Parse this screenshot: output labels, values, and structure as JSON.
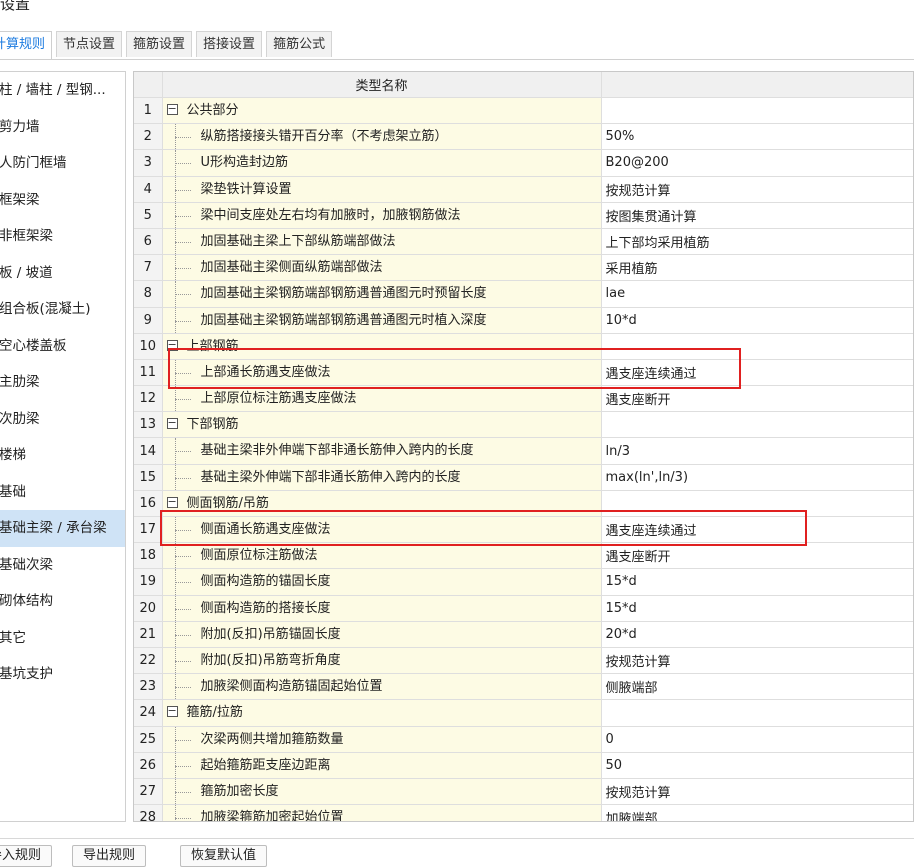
{
  "window_title": "设置",
  "tabs": [
    "计算规则",
    "节点设置",
    "箍筋设置",
    "搭接设置",
    "箍筋公式"
  ],
  "sidebar": [
    "柱 / 墙柱 / 型钢...",
    "剪力墙",
    "人防门框墙",
    "框架梁",
    "非框架梁",
    "板 / 坡道",
    "组合板(混凝土)",
    "空心楼盖板",
    "主肋梁",
    "次肋梁",
    "楼梯",
    "基础",
    "基础主梁 / 承台梁",
    "基础次梁",
    "砌体结构",
    "其它",
    "基坑支护"
  ],
  "grid": {
    "col_header": "类型名称",
    "rows": [
      {
        "n": "1",
        "name": "公共部分",
        "value": "",
        "group": true
      },
      {
        "n": "2",
        "name": "纵筋搭接接头错开百分率（不考虑架立筋）",
        "value": "50%"
      },
      {
        "n": "3",
        "name": "U形构造封边筋",
        "value": "B20@200"
      },
      {
        "n": "4",
        "name": "梁垫铁计算设置",
        "value": "按规范计算"
      },
      {
        "n": "5",
        "name": "梁中间支座处左右均有加腋时，加腋钢筋做法",
        "value": "按图集贯通计算"
      },
      {
        "n": "6",
        "name": "加固基础主梁上下部纵筋端部做法",
        "value": "上下部均采用植筋"
      },
      {
        "n": "7",
        "name": "加固基础主梁侧面纵筋端部做法",
        "value": "采用植筋"
      },
      {
        "n": "8",
        "name": "加固基础主梁钢筋端部钢筋遇普通图元时预留长度",
        "value": "lae"
      },
      {
        "n": "9",
        "name": "加固基础主梁钢筋端部钢筋遇普通图元时植入深度",
        "value": "10*d"
      },
      {
        "n": "10",
        "name": "上部钢筋",
        "value": "",
        "group": true
      },
      {
        "n": "11",
        "name": "上部通长筋遇支座做法",
        "value": "遇支座连续通过"
      },
      {
        "n": "12",
        "name": "上部原位标注筋遇支座做法",
        "value": "遇支座断开"
      },
      {
        "n": "13",
        "name": "下部钢筋",
        "value": "",
        "group": true
      },
      {
        "n": "14",
        "name": "基础主梁非外伸端下部非通长筋伸入跨内的长度",
        "value": "ln/3"
      },
      {
        "n": "15",
        "name": "基础主梁外伸端下部非通长筋伸入跨内的长度",
        "value": "max(ln',ln/3)"
      },
      {
        "n": "16",
        "name": "侧面钢筋/吊筋",
        "value": "",
        "group": true
      },
      {
        "n": "17",
        "name": "侧面通长筋遇支座做法",
        "value": "遇支座连续通过"
      },
      {
        "n": "18",
        "name": "侧面原位标注筋做法",
        "value": "遇支座断开"
      },
      {
        "n": "19",
        "name": "侧面构造筋的锚固长度",
        "value": "15*d"
      },
      {
        "n": "20",
        "name": "侧面构造筋的搭接长度",
        "value": "15*d"
      },
      {
        "n": "21",
        "name": "附加(反扣)吊筋锚固长度",
        "value": "20*d"
      },
      {
        "n": "22",
        "name": "附加(反扣)吊筋弯折角度",
        "value": "按规范计算"
      },
      {
        "n": "23",
        "name": "加腋梁侧面构造筋锚固起始位置",
        "value": "侧腋端部"
      },
      {
        "n": "24",
        "name": "箍筋/拉筋",
        "value": "",
        "group": true
      },
      {
        "n": "25",
        "name": "次梁两侧共增加箍筋数量",
        "value": "0"
      },
      {
        "n": "26",
        "name": "起始箍筋距支座边距离",
        "value": "50"
      },
      {
        "n": "27",
        "name": "箍筋加密长度",
        "value": "按规范计算"
      },
      {
        "n": "28",
        "name": "加腋梁箍筋加密起始位置",
        "value": "加腋端部"
      }
    ]
  },
  "buttons": [
    "导入规则",
    "导出规则",
    "恢复默认值"
  ],
  "colors": {
    "accent": "#1e7ce0",
    "highlight": "#e02020",
    "name_bg": "#fdfbe4",
    "selected_bg": "#cfe3f6"
  }
}
